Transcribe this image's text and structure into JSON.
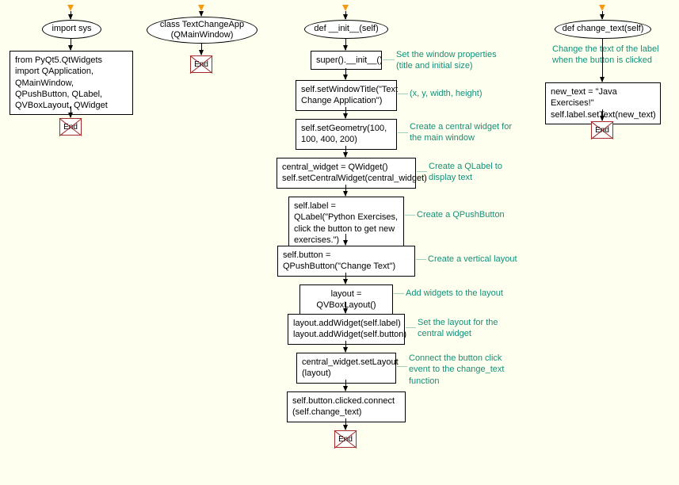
{
  "columns": {
    "c1": {
      "top": "import sys",
      "rect1": "from PyQt5.QtWidgets import QApplication, QMainWindow, QPushButton, QLabel, QVBoxLayout, QWidget",
      "end": "End"
    },
    "c2": {
      "top": "class TextChangeApp (QMainWindow)",
      "end": "End"
    },
    "c3": {
      "top": "def __init__(self)",
      "rect1": "super().__init__()",
      "rect2": "self.setWindowTitle(\"Text Change Application\")",
      "rect3": "self.setGeometry(100, 100, 400, 200)",
      "rect4": "central_widget = QWidget() self.setCentralWidget(central_widget)",
      "rect5": "self.label = QLabel(\"Python Exercises, click the button to get new exercises.\")",
      "rect6": "self.button = QPushButton(\"Change Text\")",
      "rect7": "layout = QVBoxLayout()",
      "rect8": "layout.addWidget(self.label) layout.addWidget(self.button)",
      "rect9": "central_widget.setLayout (layout)",
      "rect10": "self.button.clicked.connect (self.change_text)",
      "end": "End",
      "ann1": "Set the window properties (title and initial size)",
      "ann2": "(x, y, width, height)",
      "ann3": "Create a central widget for the main window",
      "ann4": "Create a QLabel to display text",
      "ann5": "Create a QPushButton",
      "ann6": "Create a vertical layout",
      "ann7": "Add widgets to the layout",
      "ann8": "Set the layout for the central widget",
      "ann9": "Connect the button click event to the change_text function"
    },
    "c4": {
      "top": "def change_text(self)",
      "rect1": "new_text = \"Java Exercises!\" self.label.setText(new_text)",
      "end": "End",
      "ann1": "Change the text of the label when the button is clicked"
    }
  }
}
